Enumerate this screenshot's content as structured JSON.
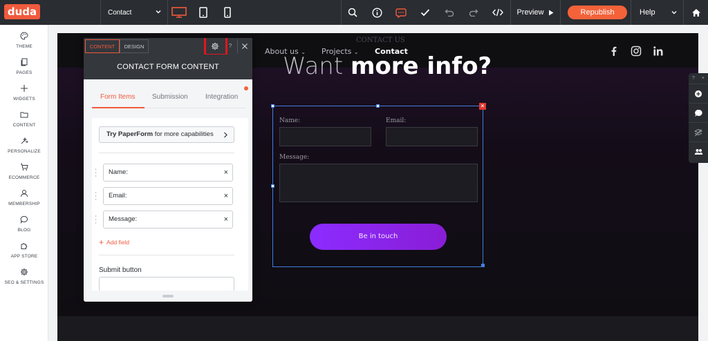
{
  "topbar": {
    "logo": "duda",
    "page": "Contact",
    "preview_label": "Preview",
    "republish_label": "Republish",
    "help_label": "Help"
  },
  "sidebar": {
    "items": [
      {
        "label": "THEME",
        "icon": "palette-icon"
      },
      {
        "label": "PAGES",
        "icon": "pages-icon"
      },
      {
        "label": "WIDGETS",
        "icon": "plus-icon"
      },
      {
        "label": "CONTENT",
        "icon": "folder-icon"
      },
      {
        "label": "PERSONALIZE",
        "icon": "personalize-icon"
      },
      {
        "label": "ECOMMERCE",
        "icon": "cart-icon"
      },
      {
        "label": "MEMBERSHIP",
        "icon": "user-icon"
      },
      {
        "label": "BLOG",
        "icon": "chat-bubble-icon"
      },
      {
        "label": "APP STORE",
        "icon": "puzzle-icon"
      },
      {
        "label": "SEO & SETTINGS",
        "icon": "gear-icon"
      }
    ]
  },
  "site": {
    "nav": [
      {
        "label": "About us"
      },
      {
        "label": "Projects"
      },
      {
        "label": "Contact"
      }
    ],
    "section_label": "CONTACT US",
    "hero_light": "Want ",
    "hero_bold": "more info?",
    "form": {
      "name_label": "Name:",
      "email_label": "Email:",
      "message_label": "Message:",
      "submit_label": "Be in touch"
    }
  },
  "panel": {
    "tab_content": "CONTENT",
    "tab_design": "DESIGN",
    "help_label": "?",
    "title": "CONTACT FORM CONTENT",
    "subtabs": [
      "Form Items",
      "Submission",
      "Integration"
    ],
    "paperform_bold": "Try PaperForm",
    "paperform_rest": " for more capabilities",
    "fields": [
      "Name:",
      "Email:",
      "Message:"
    ],
    "add_field_label": "Add field",
    "submit_section_label": "Submit button"
  },
  "right_toolbar": {
    "help": "?",
    "close": "×"
  },
  "colors": {
    "brand_orange": "#f15a3d",
    "topbar": "#2a2d32",
    "selection_blue": "#3f7fe0",
    "highlight_red": "#e3151a",
    "button_purple": "#8b2cff"
  }
}
